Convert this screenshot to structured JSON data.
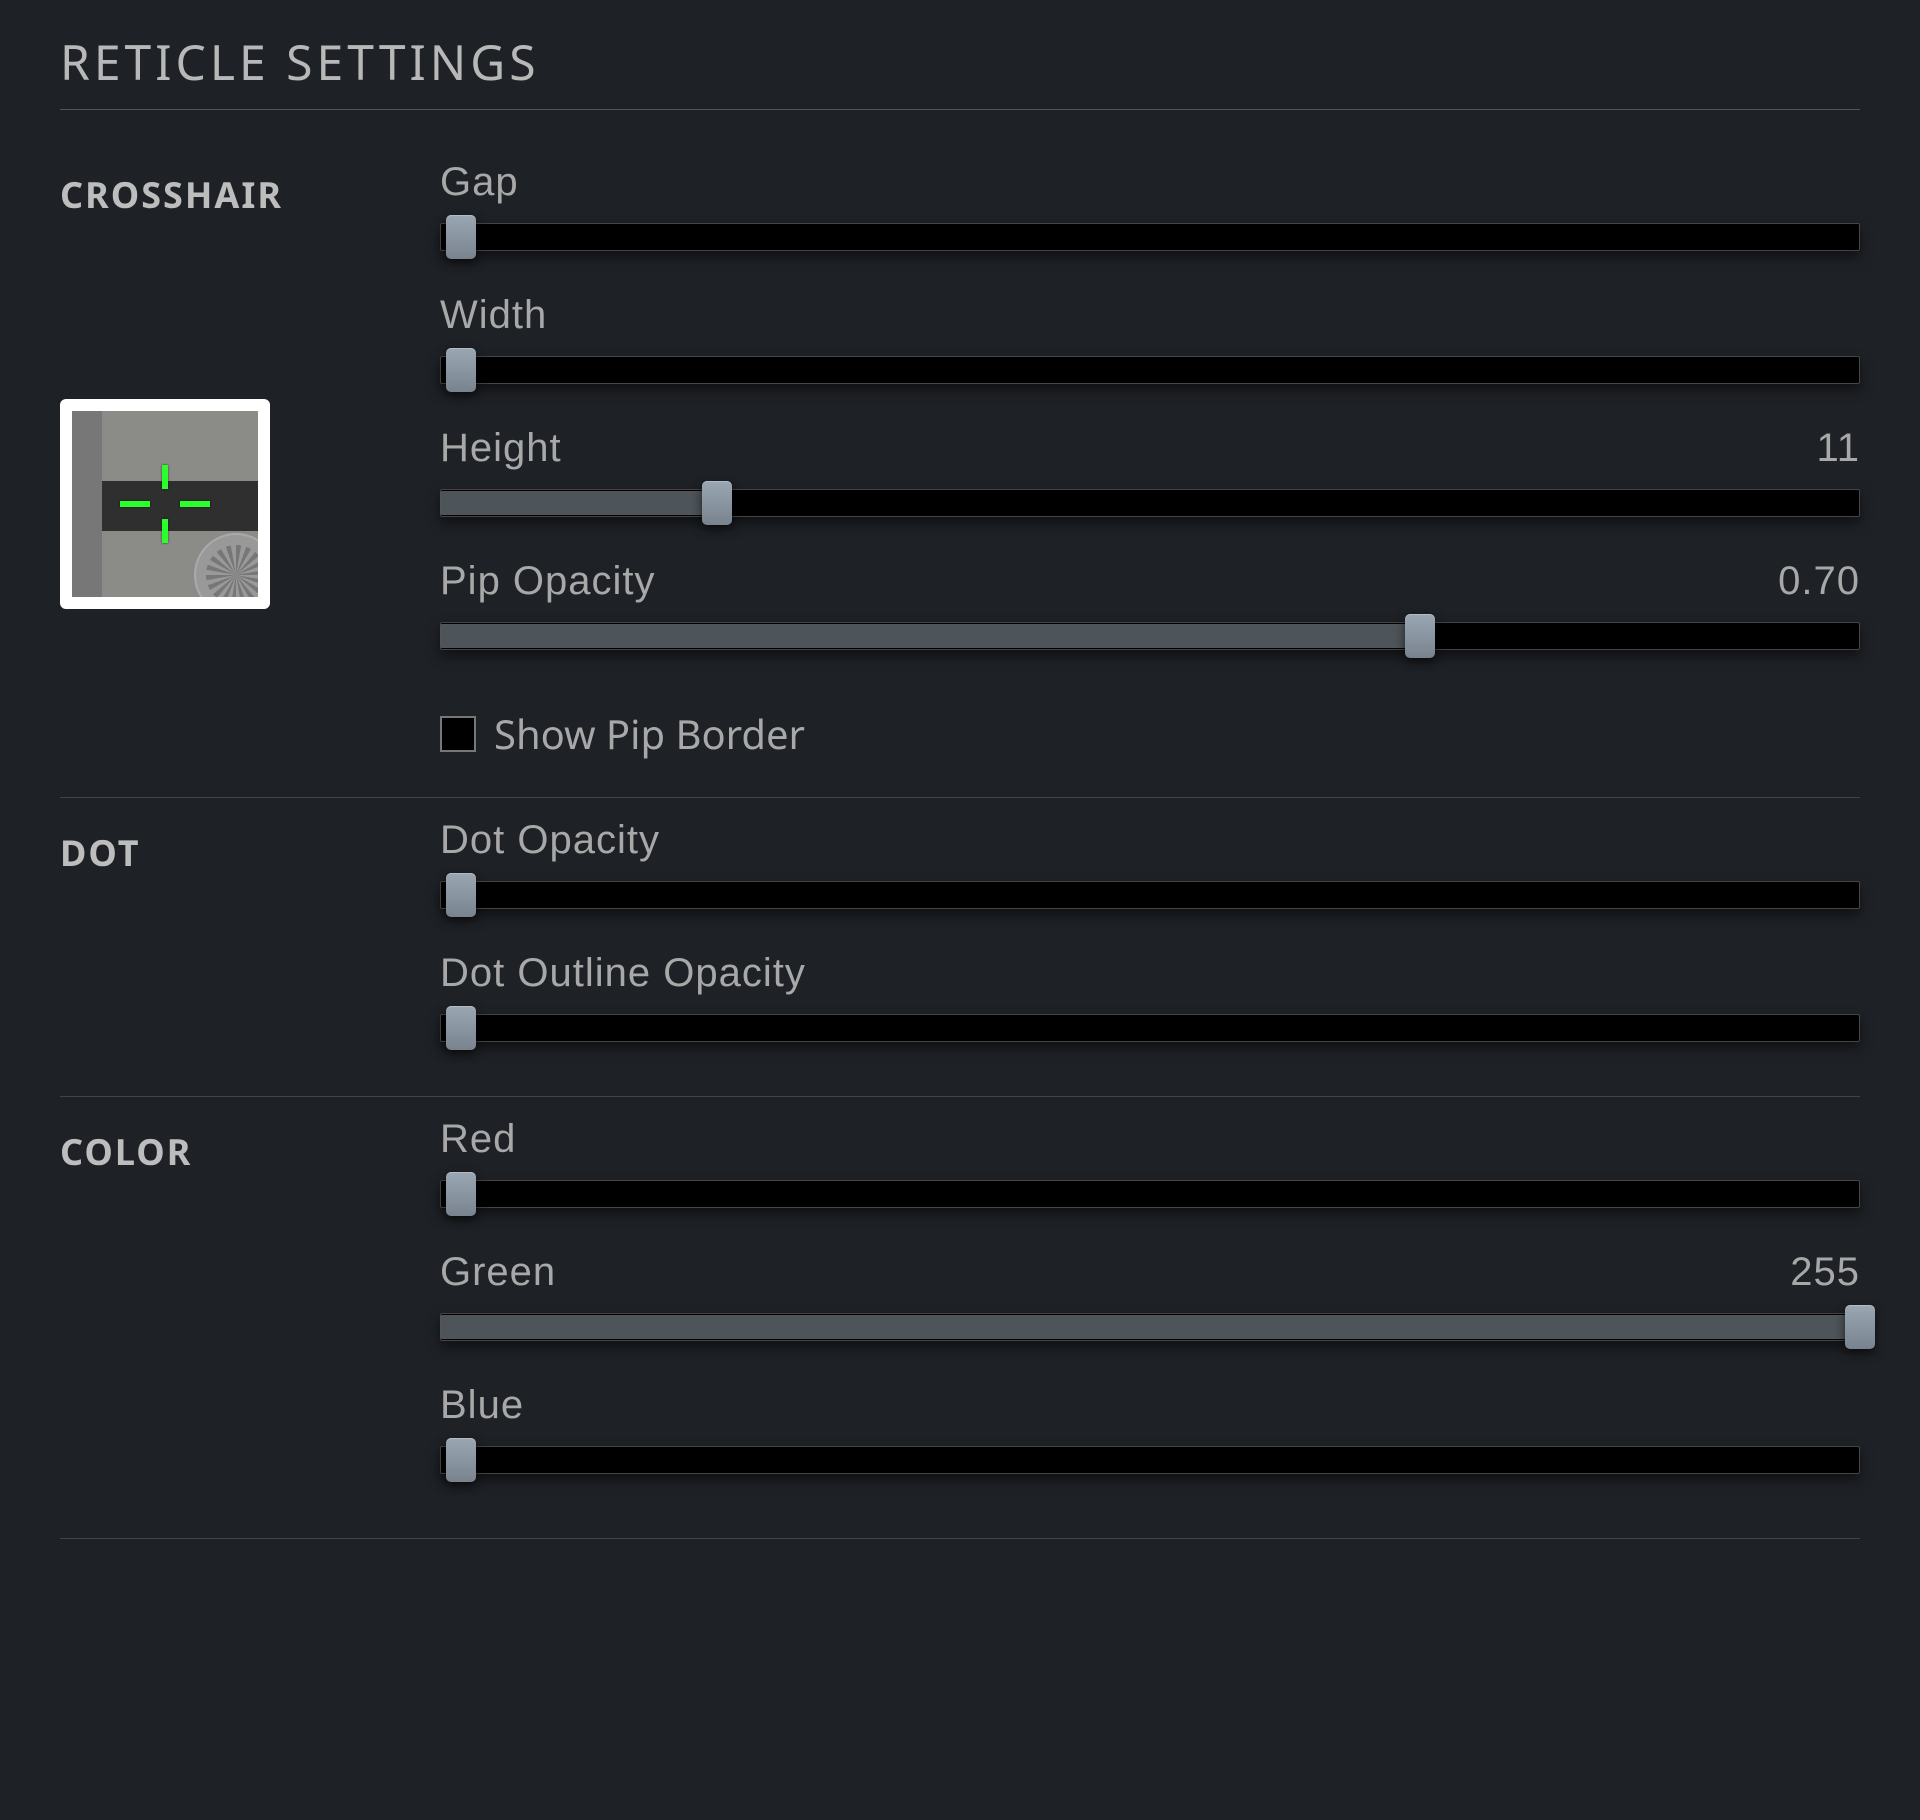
{
  "panel": {
    "title": "RETICLE SETTINGS"
  },
  "sections": {
    "crosshair": {
      "label": "CROSSHAIR",
      "gap": {
        "label": "Gap",
        "value": "",
        "pct": 1.5
      },
      "width": {
        "label": "Width",
        "value": "",
        "pct": 1.5
      },
      "height": {
        "label": "Height",
        "value": "11",
        "pct": 19.5
      },
      "pipOpacity": {
        "label": "Pip Opacity",
        "value": "0.70",
        "pct": 69
      },
      "showPipBorder": {
        "label": "Show Pip Border",
        "checked": false
      }
    },
    "dot": {
      "label": "DOT",
      "dotOpacity": {
        "label": "Dot Opacity",
        "value": "",
        "pct": 1.5
      },
      "dotOutlineOpacity": {
        "label": "Dot Outline Opacity",
        "value": "",
        "pct": 1.5
      }
    },
    "color": {
      "label": "COLOR",
      "red": {
        "label": "Red",
        "value": "",
        "pct": 1.5
      },
      "green": {
        "label": "Green",
        "value": "255",
        "pct": 100
      },
      "blue": {
        "label": "Blue",
        "value": "",
        "pct": 1.5
      }
    }
  },
  "reticle_preview_color": "#2bff2b"
}
